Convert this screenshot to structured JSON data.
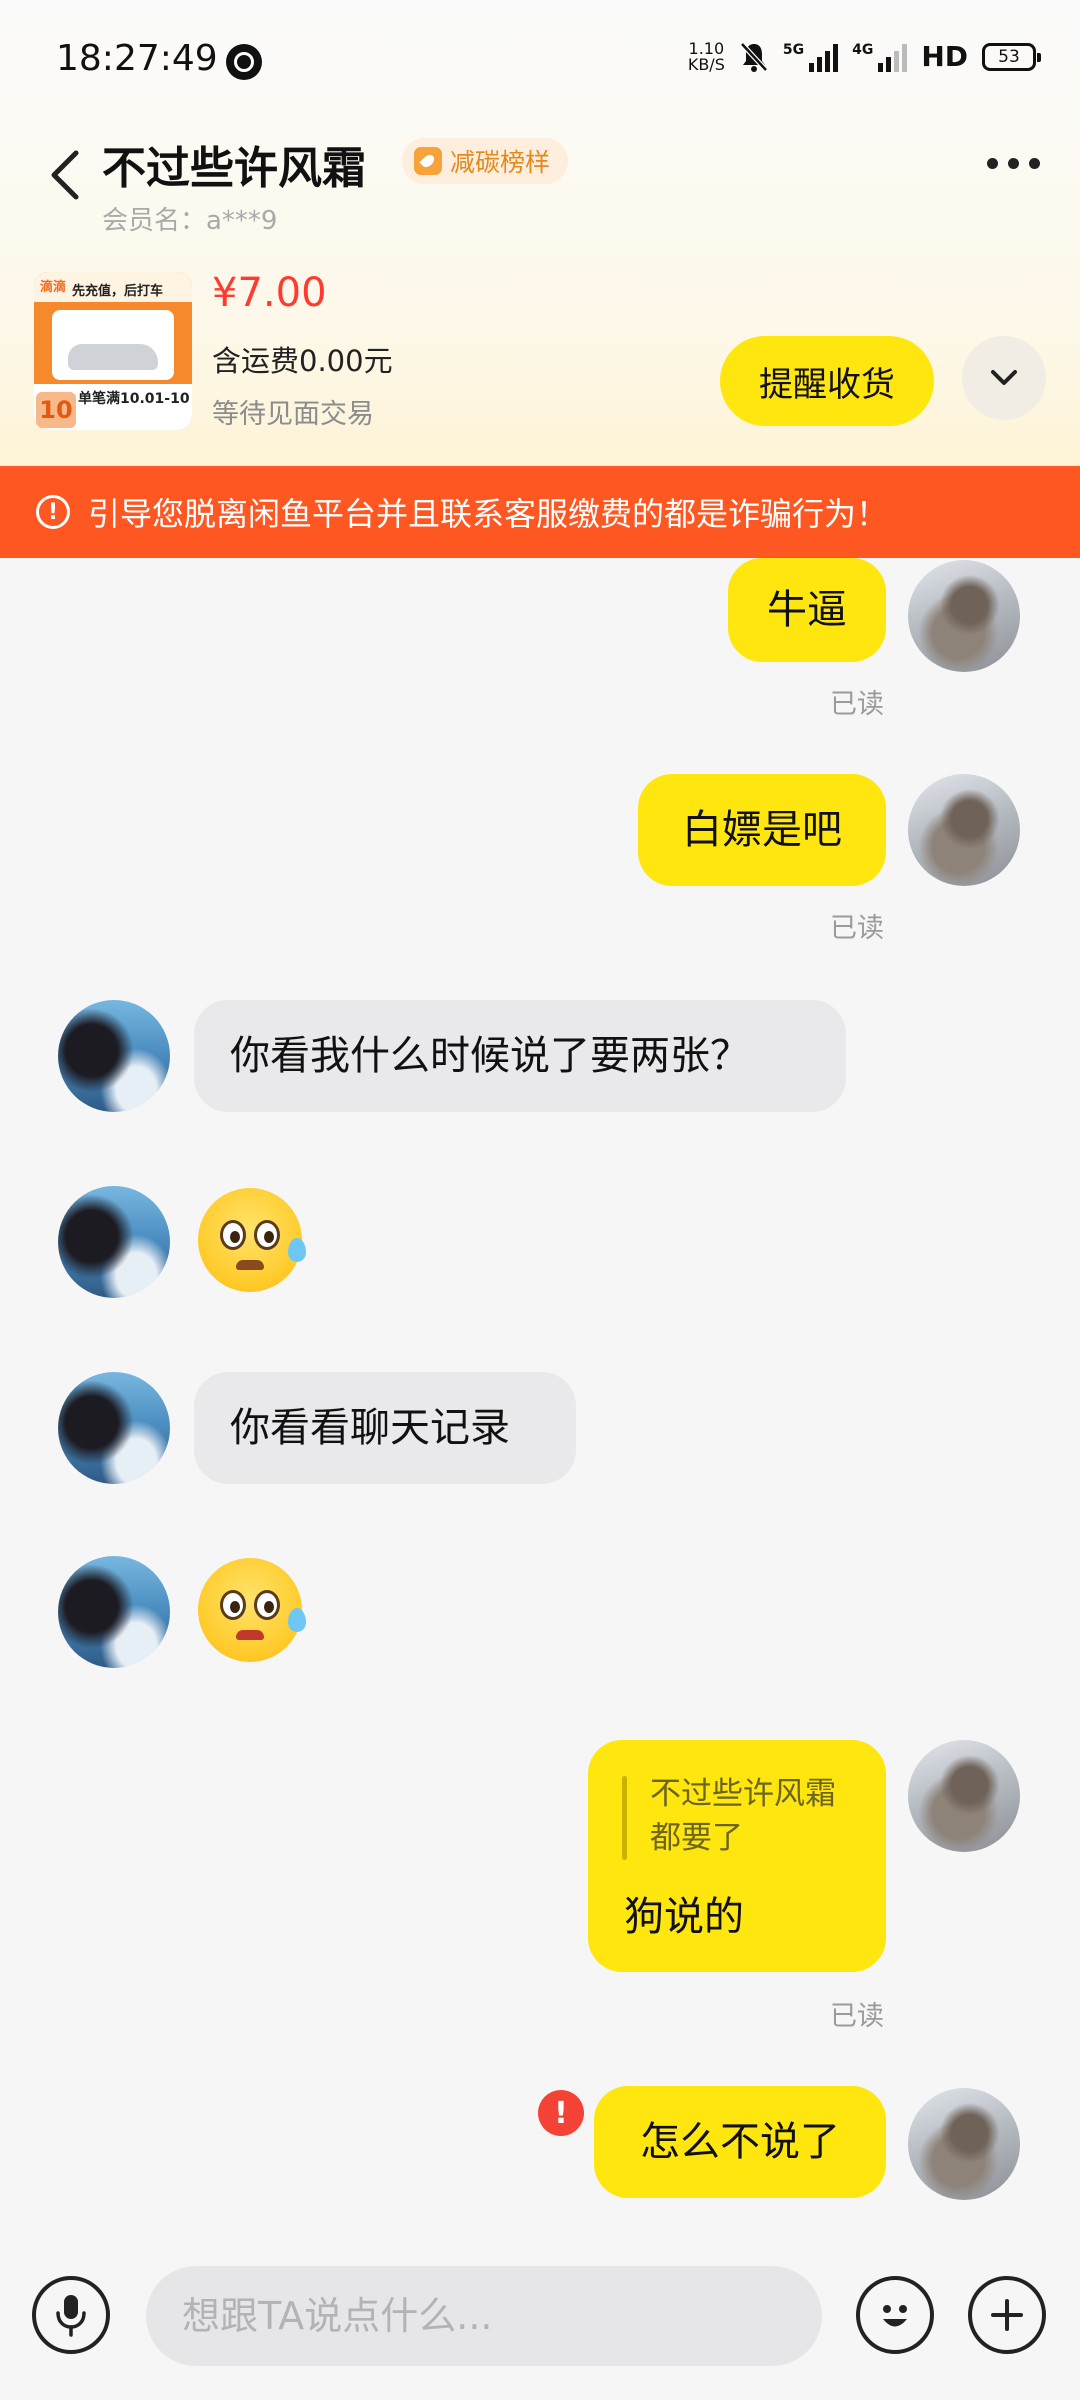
{
  "status_bar": {
    "time": "18:27:49",
    "net_speed_top": "1.10",
    "net_speed_bottom": "KB/S",
    "signal1": "5G",
    "signal2": "4G",
    "hd": "HD",
    "battery": "53"
  },
  "header": {
    "contact_name": "不过些许风霜",
    "badge": "减碳榜样",
    "member": "会员名：a***9"
  },
  "product": {
    "thumb_tag": "滴滴",
    "thumb_head": "先充值，后打车",
    "thumb_line": "单笔满10.01-10",
    "thumb_value": "10",
    "price": "¥7.00",
    "shipping": "含运费0.00元",
    "status": "等待见面交易",
    "remind_button": "提醒收货"
  },
  "warning": {
    "text": "引导您脱离闲鱼平台并且联系客服缴费的都是诈骗行为！"
  },
  "messages": {
    "m1": "牛逼",
    "m1_read": "已读",
    "m2": "白嫖是吧",
    "m2_read": "已读",
    "m3": "你看我什么时候说了要两张？",
    "m5": "你看看聊天记录",
    "m7_quote": "不过些许风霜\n都要了",
    "m7": "狗说的",
    "m7_read": "已读",
    "m8": "怎么不说了",
    "m8_fail": "!"
  },
  "input": {
    "placeholder": "想跟TA说点什么..."
  },
  "colors": {
    "accent_yellow": "#ffe60f",
    "warning_orange": "#ff5722",
    "price_red": "#ff3b30"
  }
}
